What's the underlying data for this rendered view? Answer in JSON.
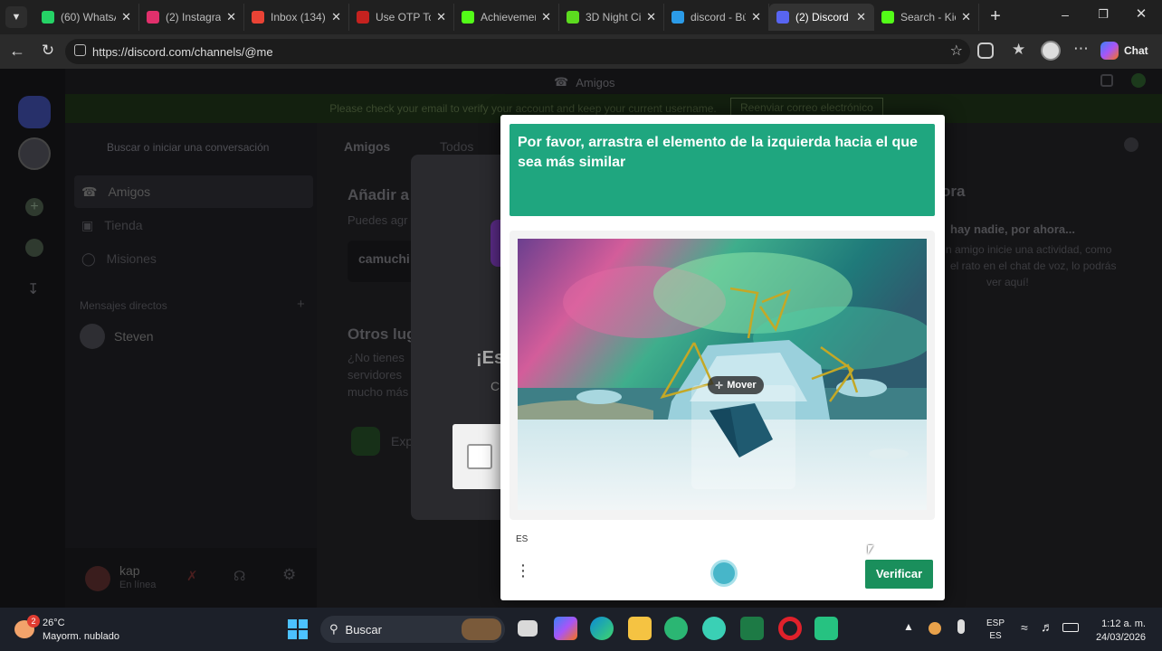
{
  "browser": {
    "tabs": [
      {
        "label": "(60) WhatsA",
        "icon": "whatsapp-icon",
        "color": "#25d366"
      },
      {
        "label": "(2) Instagram",
        "icon": "instagram-icon",
        "color": "#e1306c"
      },
      {
        "label": "Inbox (134)",
        "icon": "gmail-icon",
        "color": "#ea4335"
      },
      {
        "label": "Use OTP To",
        "icon": "gmail-icon",
        "color": "#c5221f"
      },
      {
        "label": "Achievemen",
        "icon": "kick-icon",
        "color": "#53fc18"
      },
      {
        "label": "3D Night Cit",
        "icon": "app-icon",
        "color": "#5cdb1f"
      },
      {
        "label": "discord - Bú",
        "icon": "search-icon",
        "color": "#2b9be8"
      },
      {
        "label": "(2) Discord |",
        "icon": "discord-icon",
        "color": "#5865f2"
      },
      {
        "label": "Search - Kic",
        "icon": "kick-icon",
        "color": "#53fc18"
      }
    ],
    "url": "https://discord.com/channels/@me",
    "chat_label": "Chat"
  },
  "discord": {
    "header_title": "Amigos",
    "banner_text": "Please check your email to verify your account and keep your current username.",
    "banner_button": "Reenviar correo electrónico",
    "search_placeholder": "Buscar o iniciar una conversación",
    "nav": [
      "Amigos",
      "Tienda",
      "Misiones"
    ],
    "dm_header": "Mensajes directos",
    "dm_user": "Steven",
    "tabs": [
      "Amigos",
      "Todos"
    ],
    "add_title": "Añadir a",
    "add_sub": "Puedes agr",
    "add_input": "camuchi",
    "other_title": "Otros lug",
    "other_text": [
      "¿No tienes",
      "servidores",
      "mucho más"
    ],
    "explore": "Exp",
    "activity_title": "ora",
    "activity_empty": "hay nadie, por ahora...",
    "activity_text": [
      "n amigo inicie una actividad, como",
      "el rato en el chat de voz, lo podrás",
      "ver aquí!"
    ],
    "modal_title": "¡Es",
    "modal_sub": "C",
    "user_name": "kap",
    "user_status": "En línea"
  },
  "captcha": {
    "prompt": "Por favor, arrastra el elemento de la izquierda hacia el que sea más similar",
    "move_label": "Mover",
    "lang": "ES",
    "verify_button": "Verificar",
    "accent": "#1fa67f",
    "button_color": "#1a8f5c"
  },
  "taskbar": {
    "weather_temp": "26°C",
    "weather_desc": "Mayorm. nublado",
    "weather_badge": "2",
    "search": "Buscar",
    "lang_top": "ESP",
    "lang_bottom": "ES",
    "time": "1:12 a. m.",
    "date": "24/03/2026"
  }
}
